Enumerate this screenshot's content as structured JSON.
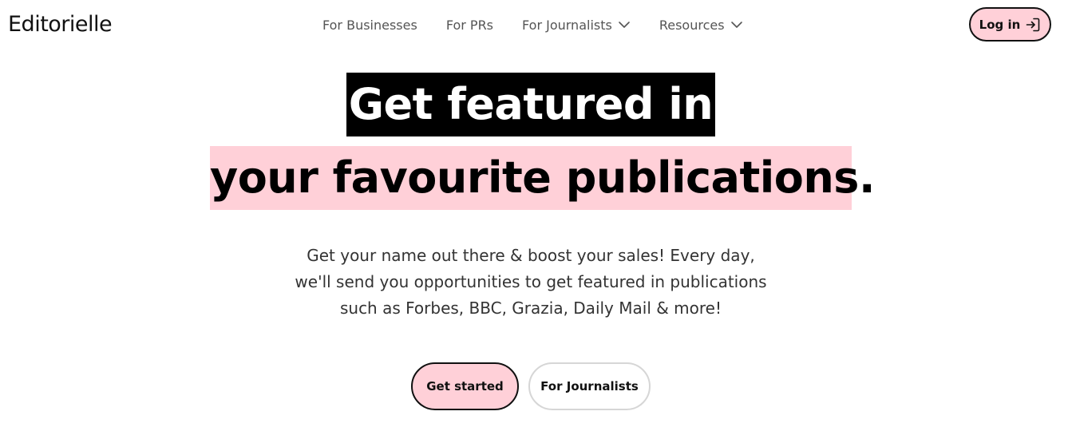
{
  "brand": {
    "logo_text": "Editorielle"
  },
  "nav": {
    "items": [
      {
        "label": "For Businesses",
        "has_dropdown": false
      },
      {
        "label": "For PRs",
        "has_dropdown": false
      },
      {
        "label": "For Journalists",
        "has_dropdown": true,
        "icon": "chevron-down-icon"
      },
      {
        "label": "Resources",
        "has_dropdown": true,
        "icon": "chevron-down-icon"
      }
    ],
    "login": {
      "label": "Log in",
      "icon": "login-arrow-icon"
    }
  },
  "hero": {
    "headline_line1": "Get featured in",
    "headline_line2": "your favourite publications.",
    "subtext_lines": [
      "Get your name out there & boost your sales! Every day,",
      "we'll send you opportunities to get featured in publications",
      "such as Forbes, BBC, Grazia, Daily Mail & more!"
    ],
    "cta_primary": "Get started",
    "cta_secondary": "For Journalists"
  },
  "colors": {
    "accent_pink": "#ffd0d8",
    "text_dark": "#111111",
    "nav_text": "#555555",
    "headline_dark_bg": "#000000"
  }
}
